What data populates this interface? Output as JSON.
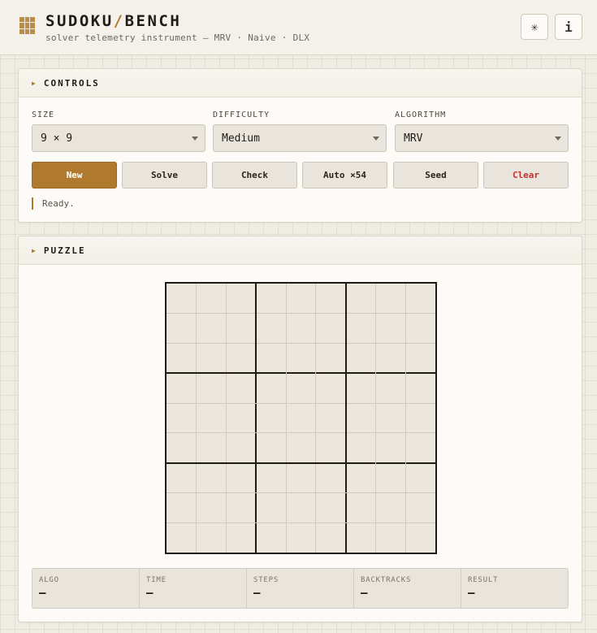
{
  "header": {
    "brand_left": "SUDOKU",
    "brand_slash": "/",
    "brand_right": "BENCH",
    "subtitle": "solver telemetry instrument — MRV · Naive · DLX",
    "theme_icon": "✳",
    "info_icon": "i"
  },
  "controls": {
    "title": "CONTROLS",
    "size_label": "SIZE",
    "size_value": "9 × 9",
    "difficulty_label": "DIFFICULTY",
    "difficulty_value": "Medium",
    "algorithm_label": "ALGORITHM",
    "algorithm_value": "MRV",
    "buttons": {
      "new": "New",
      "solve": "Solve",
      "check": "Check",
      "auto": "Auto ×54",
      "seed": "Seed",
      "clear": "Clear"
    },
    "status": "Ready."
  },
  "puzzle": {
    "title": "PUZZLE",
    "grid_size": 9,
    "box_size": 3
  },
  "telemetry": [
    {
      "label": "ALGO",
      "value": "—"
    },
    {
      "label": "TIME",
      "value": "—"
    },
    {
      "label": "STEPS",
      "value": "—"
    },
    {
      "label": "BACKTRACKS",
      "value": "—"
    },
    {
      "label": "RESULT",
      "value": "—"
    }
  ],
  "colors": {
    "accent": "#b07a2e",
    "danger": "#c9302c",
    "background": "#efece4"
  }
}
